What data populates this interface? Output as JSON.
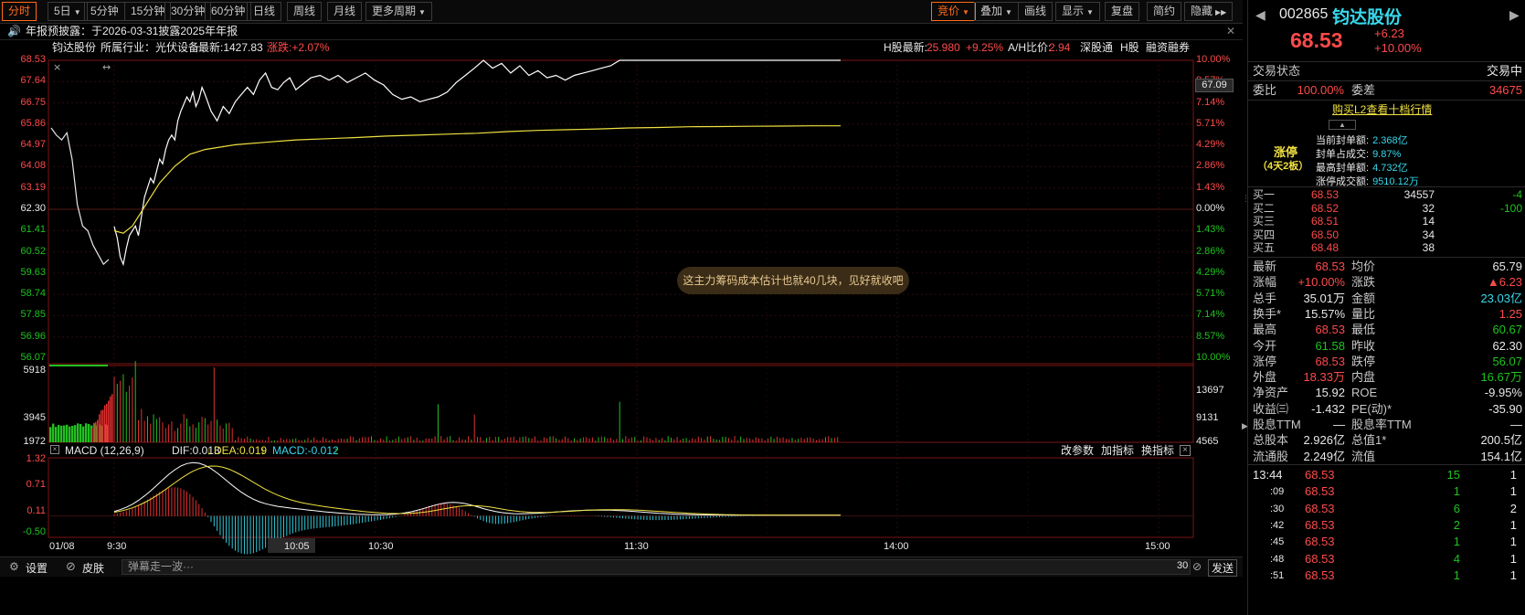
{
  "toolbar": {
    "left": [
      "分时",
      "5日",
      "5分钟",
      "15分钟",
      "30分钟",
      "60分钟",
      "日线",
      "周线",
      "月线",
      "更多周期"
    ],
    "right": [
      "竞价",
      "叠加",
      "画线",
      "显示",
      "复盘",
      "简约",
      "隐藏"
    ]
  },
  "notice": "年报预披露：于2026-03-31披露2025年年报",
  "stats": {
    "name": "钧达股份",
    "industry": "所属行业：光伏设备",
    "latest": "最新:1427.83",
    "change": "涨跌:+2.07%",
    "h_label": "H股最新:",
    "h_price": "25.980",
    "h_pct": "+9.25%",
    "ah_label": "A/H比价:",
    "ah_value": "2.94",
    "links": [
      "深股通",
      "H股",
      "融资融券"
    ]
  },
  "axis": {
    "price_left": [
      "68.53",
      "67.64",
      "66.75",
      "65.86",
      "64.97",
      "64.08",
      "63.19",
      "62.30",
      "61.41",
      "60.52",
      "59.63",
      "58.74",
      "57.85",
      "56.96",
      "56.07"
    ],
    "pct_right": [
      "10.00%",
      "8.57%",
      "7.14%",
      "5.71%",
      "4.29%",
      "2.86%",
      "1.43%",
      "0.00%",
      "1.43%",
      "2.86%",
      "4.29%",
      "5.71%",
      "7.14%",
      "8.57%",
      "10.00%"
    ],
    "cursor_price": "67.09",
    "vol_left": [
      "5918",
      "3945",
      "1972"
    ],
    "vol_right": [
      "13697",
      "9131",
      "4565"
    ],
    "macd_left": [
      "1.32",
      "0.71",
      "0.11",
      "-0.50"
    ],
    "time": [
      "01/08",
      "9:30",
      "10:05",
      "10:30",
      "11:30",
      "14:00",
      "15:00"
    ]
  },
  "macd": {
    "title": "MACD (12,26,9)",
    "dif": "DIF:0.013",
    "dea": "DEA:0.019",
    "macd": "MACD:-0.012",
    "buttons": [
      "改参数",
      "加指标",
      "换指标"
    ]
  },
  "comment": "这主力筹码成本估计也就40几块，见好就收吧",
  "bottom": {
    "settings": "设置",
    "skin": "皮肤",
    "danmu_placeholder": "弹幕走一波···",
    "count": "30",
    "send": "发送"
  },
  "panel": {
    "code": "002865",
    "name": "钧达股份",
    "price": "68.53",
    "chg": "+6.23",
    "chg_pct": "+10.00%",
    "trade_status_label": "交易状态",
    "trade_status": "交易中",
    "weibi_label": "委比",
    "weibi": "100.00%",
    "weicha_label": "委差",
    "weicha": "34675",
    "l2_link": "购买L2查看十档行情",
    "limit_label": "涨停",
    "limit_sub": "（4天2板）",
    "limit_stats": [
      {
        "k": "当前封单额:",
        "v": "2.368亿"
      },
      {
        "k": "封单占成交:",
        "v": "9.87%"
      },
      {
        "k": "最高封单额:",
        "v": "4.732亿"
      },
      {
        "k": "涨停成交额:",
        "v": "9510.12万"
      }
    ],
    "orderbook": [
      {
        "label": "买一",
        "price": "68.53",
        "vol": "34557",
        "chg": "-4"
      },
      {
        "label": "买二",
        "price": "68.52",
        "vol": "32",
        "chg": "-100"
      },
      {
        "label": "买三",
        "price": "68.51",
        "vol": "14",
        "chg": ""
      },
      {
        "label": "买四",
        "price": "68.50",
        "vol": "34",
        "chg": ""
      },
      {
        "label": "买五",
        "price": "68.48",
        "vol": "38",
        "chg": ""
      }
    ],
    "quotes": [
      {
        "l1": "最新",
        "v1": "68.53",
        "c1": "red",
        "l2": "均价",
        "v2": "65.79",
        "c2": "white"
      },
      {
        "l1": "涨幅",
        "v1": "+10.00%",
        "c1": "red",
        "l2": "涨跌",
        "v2": "▲6.23",
        "c2": "red"
      },
      {
        "l1": "总手",
        "v1": "35.01万",
        "c1": "white",
        "l2": "金额",
        "v2": "23.03亿",
        "c2": "cyan"
      },
      {
        "l1": "换手*",
        "v1": "15.57%",
        "c1": "white",
        "l2": "量比",
        "v2": "1.25",
        "c2": "red"
      },
      {
        "l1": "最高",
        "v1": "68.53",
        "c1": "red",
        "l2": "最低",
        "v2": "60.67",
        "c2": "green"
      },
      {
        "l1": "今开",
        "v1": "61.58",
        "c1": "green",
        "l2": "昨收",
        "v2": "62.30",
        "c2": "white"
      },
      {
        "l1": "涨停",
        "v1": "68.53",
        "c1": "red",
        "l2": "跌停",
        "v2": "56.07",
        "c2": "green"
      },
      {
        "l1": "外盘",
        "v1": "18.33万",
        "c1": "red",
        "l2": "内盘",
        "v2": "16.67万",
        "c2": "green"
      },
      {
        "l1": "净资产",
        "v1": "15.92",
        "c1": "white",
        "l2": "ROE",
        "v2": "-9.95%",
        "c2": "white"
      },
      {
        "l1": "收益㈢",
        "v1": "-1.432",
        "c1": "white",
        "l2": "PE(动)*",
        "v2": "-35.90",
        "c2": "white"
      },
      {
        "l1": "股息TTM",
        "v1": "—",
        "c1": "white",
        "l2": "股息率TTM",
        "v2": "—",
        "c2": "white"
      },
      {
        "l1": "总股本",
        "v1": "2.926亿",
        "c1": "white",
        "l2": "总值1*",
        "v2": "200.5亿",
        "c2": "white"
      },
      {
        "l1": "流通股",
        "v1": "2.249亿",
        "c1": "white",
        "l2": "流值",
        "v2": "154.1亿",
        "c2": "white"
      }
    ],
    "ticks": [
      {
        "t": "13:44",
        "p": "68.53",
        "v": "15",
        "n": "1"
      },
      {
        "t": ":09",
        "p": "68.53",
        "v": "1",
        "n": "1"
      },
      {
        "t": ":30",
        "p": "68.53",
        "v": "6",
        "n": "2"
      },
      {
        "t": ":42",
        "p": "68.53",
        "v": "2",
        "n": "1"
      },
      {
        "t": ":45",
        "p": "68.53",
        "v": "1",
        "n": "1"
      },
      {
        "t": ":48",
        "p": "68.53",
        "v": "4",
        "n": "1"
      },
      {
        "t": ":51",
        "p": "68.53",
        "v": "1",
        "n": "1"
      }
    ]
  },
  "chart_data": {
    "type": "line",
    "prev_close": 62.3,
    "ylim": [
      56.07,
      68.53
    ],
    "price_x_minutes": [
      0,
      1,
      2,
      3,
      4,
      5,
      6,
      7,
      8,
      9,
      10,
      11,
      12,
      13,
      14,
      15,
      16,
      17,
      18,
      19,
      20,
      21,
      22,
      23,
      24,
      25,
      26,
      27,
      28,
      29,
      30,
      32,
      34,
      36,
      38,
      40,
      42,
      44,
      46,
      48,
      50,
      52,
      54,
      56,
      58,
      60,
      62,
      65,
      68,
      71,
      74,
      77,
      80,
      83,
      86,
      89,
      92,
      95,
      98,
      101,
      104,
      107,
      110,
      113,
      116,
      119,
      122,
      125,
      128,
      131,
      134,
      137,
      140,
      143,
      146,
      149,
      152,
      155,
      158,
      161,
      164,
      167,
      170,
      173,
      176,
      179,
      182,
      185,
      188,
      191,
      194,
      197,
      200,
      204,
      208,
      212,
      216,
      220,
      224,
      228,
      232,
      236,
      240
    ],
    "price": [
      61.58,
      61.1,
      60.3,
      60.0,
      60.67,
      61.2,
      61.4,
      61.6,
      61.2,
      62.0,
      62.8,
      63.2,
      63.6,
      63.4,
      63.9,
      64.4,
      64.2,
      64.8,
      65.2,
      65.4,
      65.2,
      66.0,
      66.4,
      66.7,
      67.0,
      66.8,
      67.2,
      66.6,
      66.9,
      67.4,
      67.1,
      66.4,
      66.0,
      66.6,
      66.3,
      66.8,
      67.1,
      67.4,
      67.1,
      67.7,
      68.0,
      67.4,
      67.3,
      67.6,
      67.8,
      67.3,
      67.5,
      67.8,
      67.9,
      67.7,
      67.9,
      67.6,
      67.8,
      68.0,
      67.7,
      67.5,
      67.1,
      66.9,
      67.0,
      66.8,
      66.9,
      67.0,
      67.2,
      67.6,
      67.9,
      68.2,
      68.53,
      68.2,
      68.4,
      68.0,
      68.3,
      67.9,
      68.1,
      67.8,
      67.9,
      67.7,
      67.9,
      68.0,
      68.1,
      68.2,
      68.3,
      68.53,
      68.53,
      68.53,
      68.53,
      68.53,
      68.53,
      68.53,
      68.53,
      68.53,
      68.53,
      68.53,
      68.53,
      68.53,
      68.53,
      68.53,
      68.53,
      68.53,
      68.53,
      68.53,
      68.53,
      68.53,
      68.53
    ],
    "avg_x_minutes": [
      0,
      3,
      6,
      10,
      15,
      20,
      25,
      30,
      40,
      50,
      60,
      70,
      80,
      90,
      100,
      110,
      120,
      130,
      140,
      150,
      160,
      170,
      180,
      190,
      200,
      210,
      220,
      230,
      240
    ],
    "avg": [
      61.4,
      61.3,
      61.6,
      62.4,
      63.4,
      64.1,
      64.6,
      64.8,
      65.0,
      65.1,
      65.2,
      65.25,
      65.3,
      65.36,
      65.4,
      65.44,
      65.48,
      65.55,
      65.6,
      65.63,
      65.66,
      65.7,
      65.72,
      65.75,
      65.76,
      65.77,
      65.78,
      65.79,
      65.79
    ],
    "pre_market_price": [
      65.7,
      65.4,
      65.2,
      65.5,
      64.4,
      62.5,
      61.6,
      61.4,
      60.8,
      60.4,
      60.0,
      60.2
    ],
    "volume_scale": [
      0,
      5918
    ],
    "macd_ylim": [
      -0.5,
      1.32
    ]
  }
}
